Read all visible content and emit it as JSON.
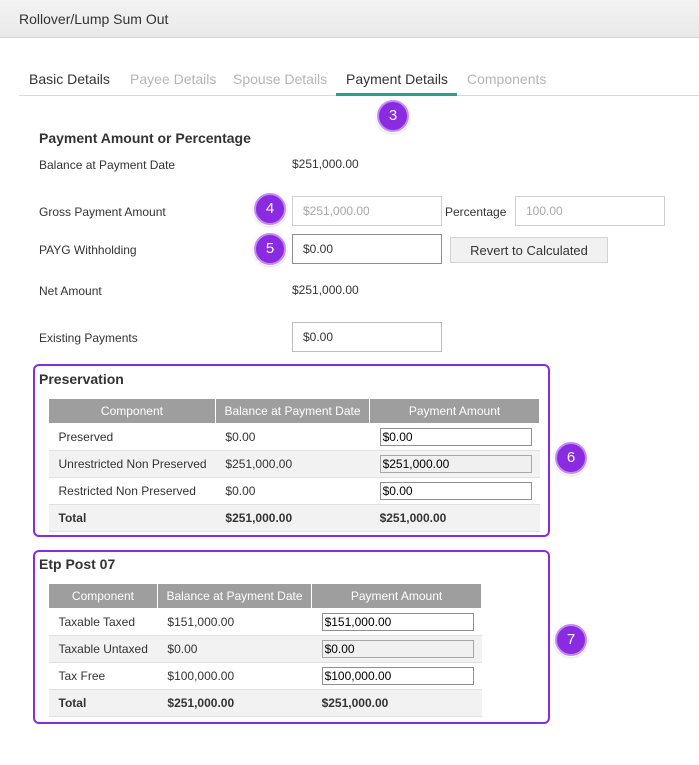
{
  "window": {
    "title": "Rollover/Lump Sum Out"
  },
  "tabs": [
    {
      "label": "Basic Details",
      "state": "enabled"
    },
    {
      "label": "Payee Details",
      "state": "disabled"
    },
    {
      "label": "Spouse Details",
      "state": "disabled"
    },
    {
      "label": "Payment Details",
      "state": "active"
    },
    {
      "label": "Components",
      "state": "disabled"
    }
  ],
  "badges": {
    "b3": "3",
    "b4": "4",
    "b5": "5",
    "b6": "6",
    "b7": "7"
  },
  "payment": {
    "section_title": "Payment Amount or Percentage",
    "balance_label": "Balance at Payment Date",
    "balance_value": "$251,000.00",
    "gross_label": "Gross Payment Amount",
    "gross_value": "$251,000.00",
    "percentage_label": "Percentage",
    "percentage_value": "100.00",
    "payg_label": "PAYG Withholding",
    "payg_value": "$0.00",
    "revert_button": "Revert to Calculated",
    "net_label": "Net Amount",
    "net_value": "$251,000.00",
    "existing_label": "Existing Payments",
    "existing_value": "$0.00"
  },
  "preservation": {
    "title": "Preservation",
    "columns": [
      "Component",
      "Balance at Payment Date",
      "Payment Amount"
    ],
    "rows": [
      {
        "component": "Preserved",
        "balance": "$0.00",
        "payment": "$0.00",
        "readonly": false
      },
      {
        "component": "Unrestricted Non Preserved",
        "balance": "$251,000.00",
        "payment": "$251,000.00",
        "readonly": true
      },
      {
        "component": "Restricted Non Preserved",
        "balance": "$0.00",
        "payment": "$0.00",
        "readonly": false
      }
    ],
    "total": {
      "label": "Total",
      "balance": "$251,000.00",
      "payment": "$251,000.00"
    }
  },
  "etp": {
    "title": "Etp Post 07",
    "columns": [
      "Component",
      "Balance at Payment Date",
      "Payment Amount"
    ],
    "rows": [
      {
        "component": "Taxable Taxed",
        "balance": "$151,000.00",
        "payment": "$151,000.00",
        "readonly": false
      },
      {
        "component": "Taxable Untaxed",
        "balance": "$0.00",
        "payment": "$0.00",
        "readonly": true
      },
      {
        "component": "Tax Free",
        "balance": "$100,000.00",
        "payment": "$100,000.00",
        "readonly": false
      }
    ],
    "total": {
      "label": "Total",
      "balance": "$251,000.00",
      "payment": "$251,000.00"
    }
  },
  "colors": {
    "accent": "#25a08c",
    "highlight": "#8a2be2",
    "header_gray": "#9e9e9e"
  }
}
